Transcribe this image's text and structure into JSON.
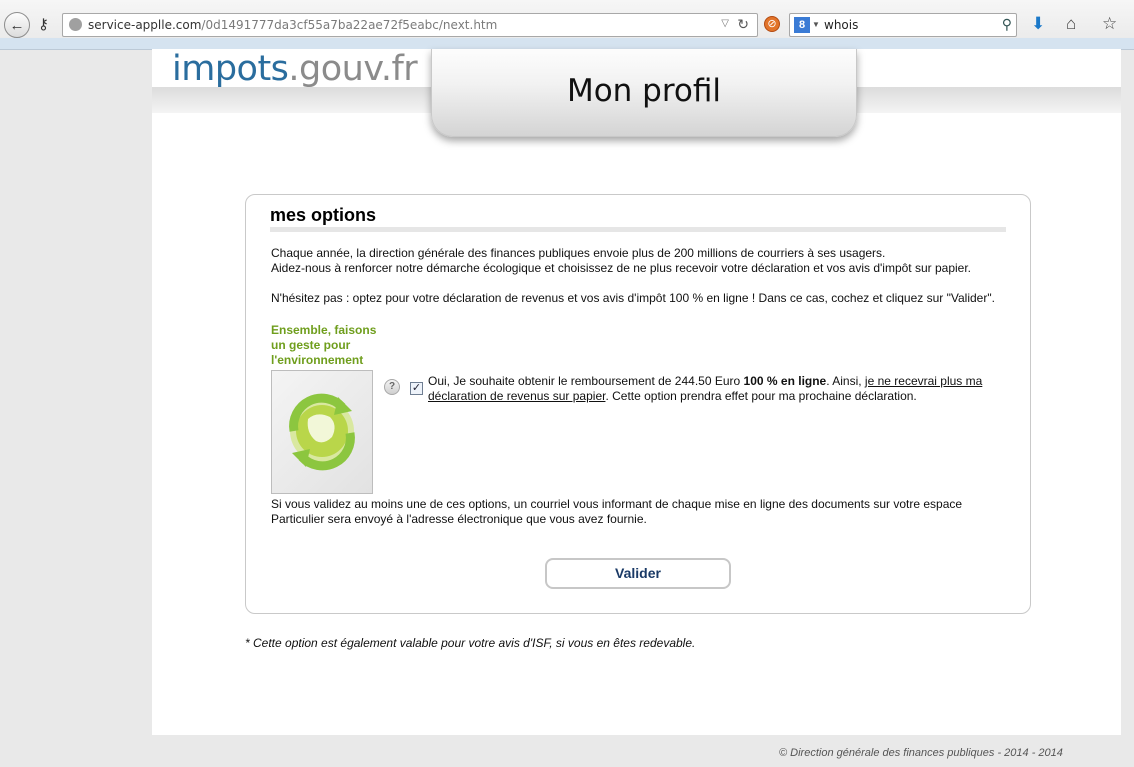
{
  "browser": {
    "url_domain": "service-applle.com",
    "url_path": "/0d1491777da3cf55a7ba22ae72f5eabc/next.htm",
    "search_value": "whois",
    "search_engine": "8"
  },
  "site": {
    "logo_part1": "impots",
    "logo_part2": ".gouv.fr",
    "page_title": "Mon profil"
  },
  "options": {
    "title": "mes options",
    "intro_line1": "Chaque année, la direction générale des finances publiques envoie plus de 200 millions de courriers à ses usagers.",
    "intro_line2": "Aidez-nous à renforcer notre démarche écologique et choisissez de ne plus recevoir votre déclaration et vos avis d'impôt sur papier.",
    "instruction": "N'hésitez pas : optez pour votre déclaration de revenus et vos avis d'impôt 100 % en ligne ! Dans ce cas, cochez et cliquez sur \"Valider\".",
    "green_heading": "Ensemble, faisons un geste pour l'environnement",
    "help": "?",
    "checkbox_checked": true,
    "option_text_part1": "Oui, Je souhaite obtenir le remboursement de 244.50 Euro ",
    "option_text_bold": "100 % en ligne",
    "option_text_part2": ". Ainsi, ",
    "option_text_link": "je ne recevrai plus ma déclaration de revenus sur papier",
    "option_text_part3": ". Cette option prendra effet pour ma prochaine déclaration.",
    "validation_info": "Si vous validez au moins une de ces options, un courriel vous informant de chaque mise en ligne des documents sur votre espace Particulier sera envoyé à l'adresse électronique que vous avez fournie.",
    "submit_label": "Valider"
  },
  "footnote": "* Cette option est également valable pour votre avis d'ISF, si vous en êtes redevable.",
  "copyright": "© Direction générale des finances publiques - 2014 - 2014",
  "colors": {
    "logo_blue": "#2a6d9e",
    "green_heading": "#6f9e1d",
    "button_text": "#1a3a66"
  },
  "icons": [
    "back-arrow-icon",
    "key-icon",
    "globe-icon",
    "dropdown-icon",
    "reload-icon",
    "noscript-icon",
    "search-engine-icon",
    "search-icon",
    "download-icon",
    "home-icon",
    "bookmark-star-icon",
    "help-icon",
    "earth-recycle-icon"
  ]
}
